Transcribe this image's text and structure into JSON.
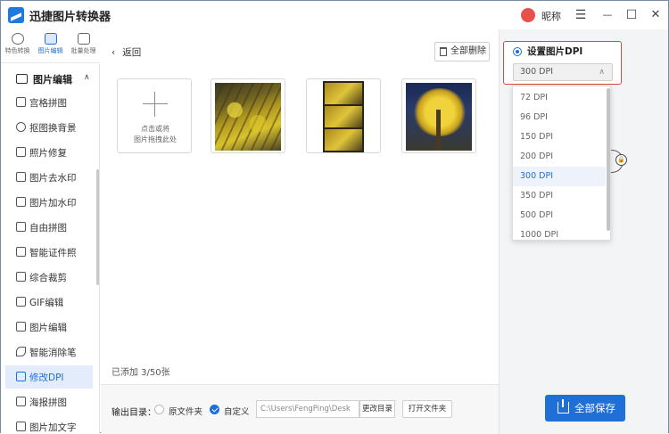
{
  "app": {
    "title": "迅捷图片转换器",
    "username": "昵称"
  },
  "window_controls": {
    "menu": "☰",
    "minimize": "—",
    "maximize": "☐",
    "close": "✕"
  },
  "left_tabs": [
    {
      "label": "特色转换",
      "active": false
    },
    {
      "label": "图片编辑",
      "active": true
    },
    {
      "label": "批量处理",
      "active": false
    }
  ],
  "sidebar": {
    "section_title": "图片编辑",
    "section_chevron": "∧",
    "items": [
      {
        "label": "宫格拼图"
      },
      {
        "label": "抠图换背景"
      },
      {
        "label": "照片修复"
      },
      {
        "label": "图片去水印"
      },
      {
        "label": "图片加水印"
      },
      {
        "label": "自由拼图"
      },
      {
        "label": "智能证件照"
      },
      {
        "label": "综合裁剪"
      },
      {
        "label": "GIF编辑"
      },
      {
        "label": "图片编辑"
      },
      {
        "label": "智能消除笔"
      },
      {
        "label": "修改DPI",
        "active": true
      },
      {
        "label": "海报拼图"
      },
      {
        "label": "图片加文字"
      }
    ]
  },
  "main": {
    "back_label": "返回",
    "back_chevron": "‹",
    "delete_all_label": "全部删除",
    "add_box": {
      "line1": "点击或将",
      "line2": "图片拖拽此处"
    },
    "count_text": "已添加 3/50张"
  },
  "footer": {
    "output_label": "输出目录：",
    "option_original": "原文件夹",
    "option_custom": "自定义",
    "path_value": "C:\\Users\\FengPing\\Desk",
    "change_dir_label": "更改目录",
    "open_folder_label": "打开文件夹"
  },
  "dpi_panel": {
    "title": "设置图片DPI",
    "selected_value": "300 DPI",
    "chevron": "∧",
    "options": [
      "72 DPI",
      "96 DPI",
      "150 DPI",
      "200 DPI",
      "300 DPI",
      "350 DPI",
      "500 DPI",
      "1000 DPI"
    ],
    "selected_index": 4,
    "lock_icon": "🔒",
    "save_all_label": "全部保存"
  },
  "colors": {
    "accent": "#1f6fd6",
    "highlight_border": "#d9483c",
    "panel_bg": "#f3f4f6"
  }
}
